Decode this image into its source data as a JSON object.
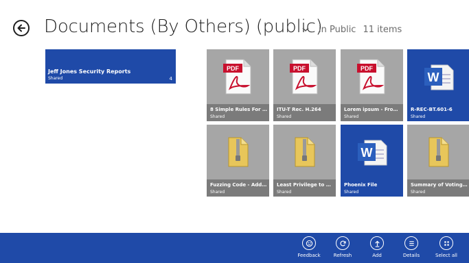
{
  "header": {
    "title": "Documents (By Others)  (public)",
    "location": "in Public",
    "count": "11 items"
  },
  "group": {
    "name": "Jeff Jones Security Reports",
    "sub": "Shared",
    "count": "4"
  },
  "files": [
    {
      "name": "8 Simple Rules For De...",
      "sub": "Shared",
      "type": "pdf-icon"
    },
    {
      "name": "ITU-T Rec. H.264",
      "sub": "Shared",
      "type": "pdf-icon"
    },
    {
      "name": "Lorem ipsum - From ...",
      "sub": "Shared",
      "type": "pdf-icon"
    },
    {
      "name": "R-REC-BT.601-6",
      "sub": "Shared",
      "type": "word-icon"
    },
    {
      "name": "Fuzzing Code - Addin...",
      "sub": "Shared",
      "type": "zip-folder-icon"
    },
    {
      "name": "Least Privilege to Use...",
      "sub": "Shared",
      "type": "zip-folder-icon"
    },
    {
      "name": "Phoenix File",
      "sub": "Shared",
      "type": "word-icon"
    },
    {
      "name": "Summary of Voting o...",
      "sub": "Shared",
      "type": "zip-folder-icon"
    }
  ],
  "appbar": {
    "feedback": "Feedback",
    "refresh": "Refresh",
    "add": "Add",
    "details": "Details",
    "select_all": "Select all"
  },
  "colors": {
    "accent": "#1f4aa8",
    "tile_gray": "#a6a6a6",
    "caption_gray": "#7b7b7b"
  }
}
